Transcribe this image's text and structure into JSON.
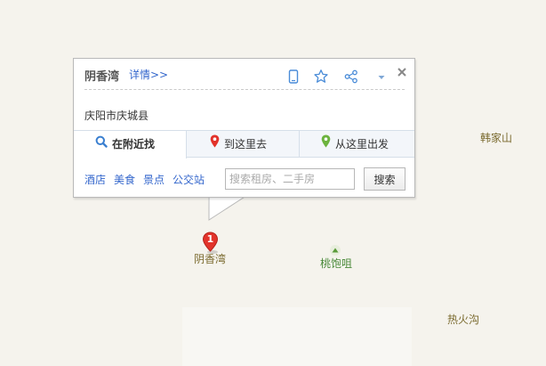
{
  "popup": {
    "title": "阴香湾",
    "detail_link": "详情>>",
    "address": "庆阳市庆城县",
    "icons": [
      "phone-icon",
      "star-icon",
      "share-icon",
      "dropdown-arrow-icon",
      "close-icon"
    ],
    "tabs": [
      {
        "label": "在附近找",
        "icon": "search-icon",
        "active": true
      },
      {
        "label": "到这里去",
        "icon": "red-pin-icon",
        "active": false
      },
      {
        "label": "从这里出发",
        "icon": "green-pin-icon",
        "active": false
      }
    ],
    "quick_links": [
      "酒店",
      "美食",
      "景点",
      "公交站"
    ],
    "search": {
      "placeholder": "搜索租房、二手房",
      "button_label": "搜索"
    }
  },
  "markers": {
    "selected": {
      "number": "1",
      "label": "阴香湾"
    }
  },
  "places": [
    {
      "label": "韩家山",
      "color": "#7a6a2e"
    },
    {
      "label": "桃饱咀",
      "color": "#4a8a3a",
      "icon": "mountain-icon"
    },
    {
      "label": "热火沟",
      "color": "#7a6a2e"
    }
  ],
  "colors": {
    "map_background": "#f5f3ed",
    "link": "#3366cc",
    "marker_red": "#e2332b"
  }
}
